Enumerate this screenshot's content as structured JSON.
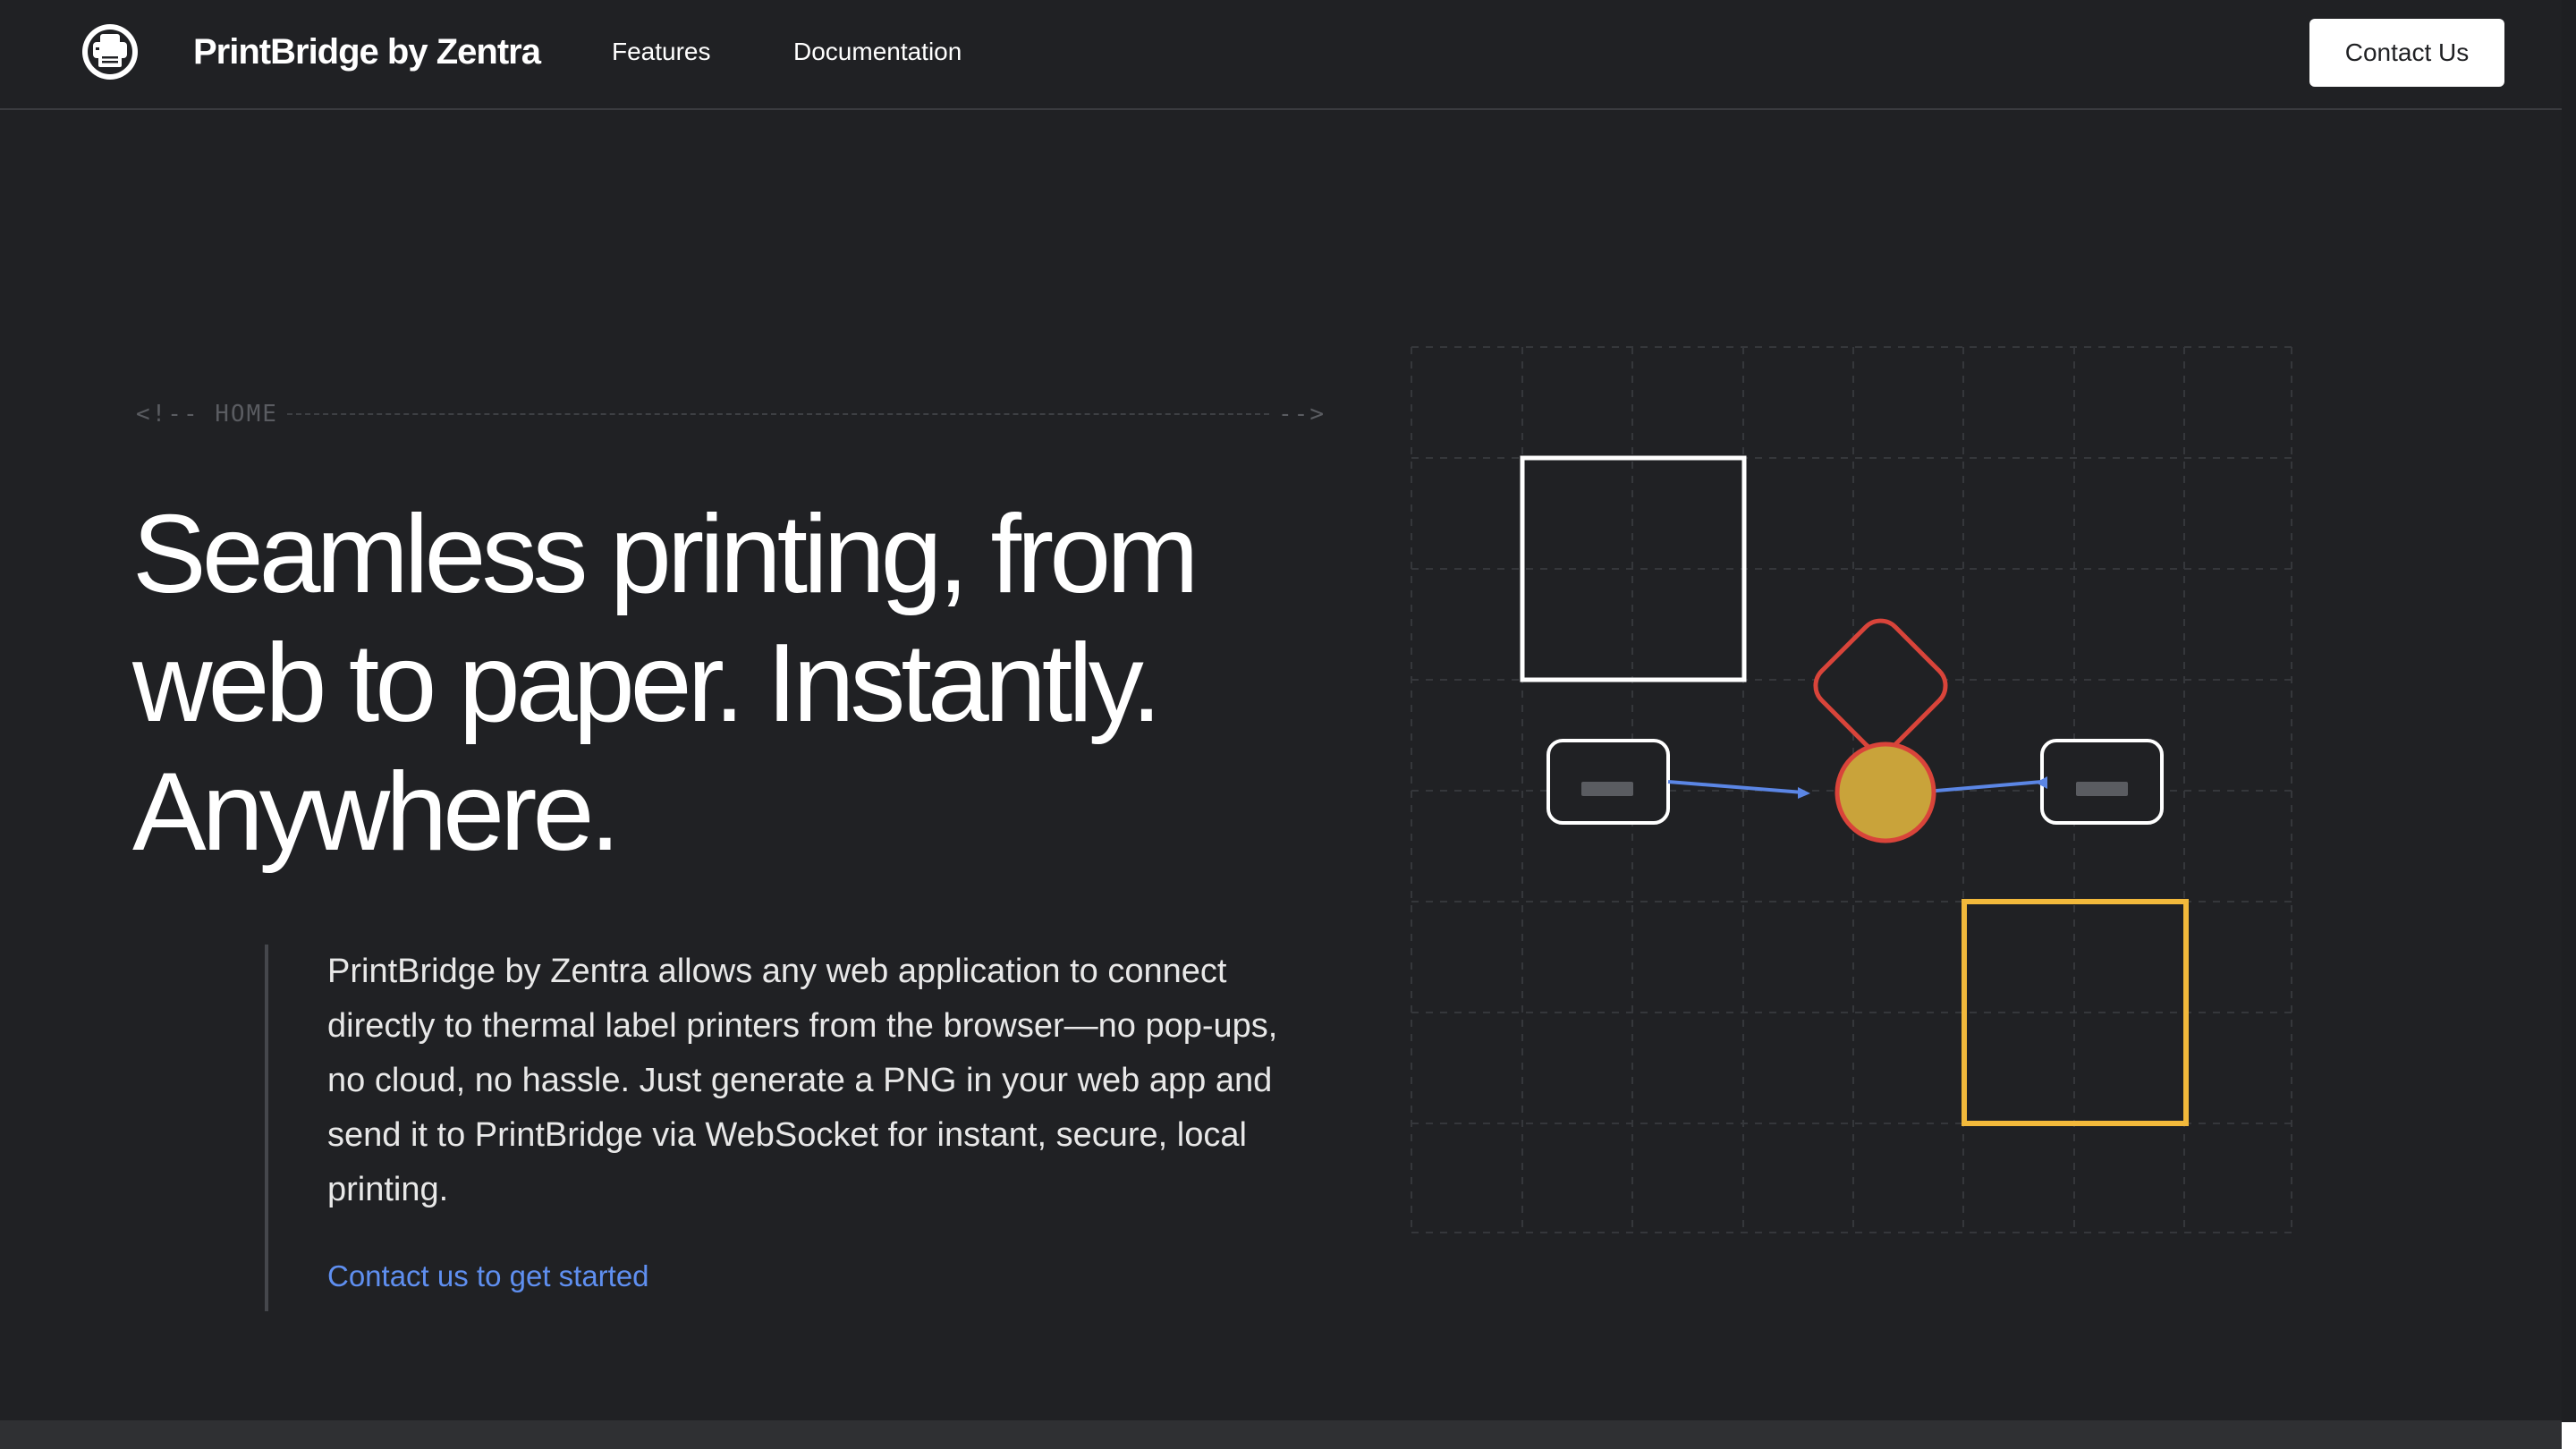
{
  "nav": {
    "logo_icon": "printer-logo-icon",
    "brand": "PrintBridge by Zentra",
    "links": [
      {
        "label": "Features"
      },
      {
        "label": "Documentation"
      }
    ],
    "contact_button": "Contact Us"
  },
  "hero": {
    "section_tag_open": "<!-- HOME",
    "section_tag_close": "-->",
    "headline": "Seamless printing, from web to paper. Instantly. Anywhere.",
    "description": "PrintBridge by Zentra allows any web application to connect directly to thermal label printers from the browser—no pop-ups, no cloud, no hassle. Just generate a PNG in your web app and send it to PrintBridge via WebSocket for instant, secure, local printing.",
    "cta_link": "Contact us to get started"
  },
  "diagram": {
    "colors": {
      "background": "#202124",
      "grid": "#35373b",
      "white_outline": "#ffffff",
      "yellow_outline": "#f2b93b",
      "red_diamond": "#d9443a",
      "gold_circle": "#c9a33a",
      "connector": "#5b86e5",
      "slot_fill": "#5a5c61"
    }
  }
}
